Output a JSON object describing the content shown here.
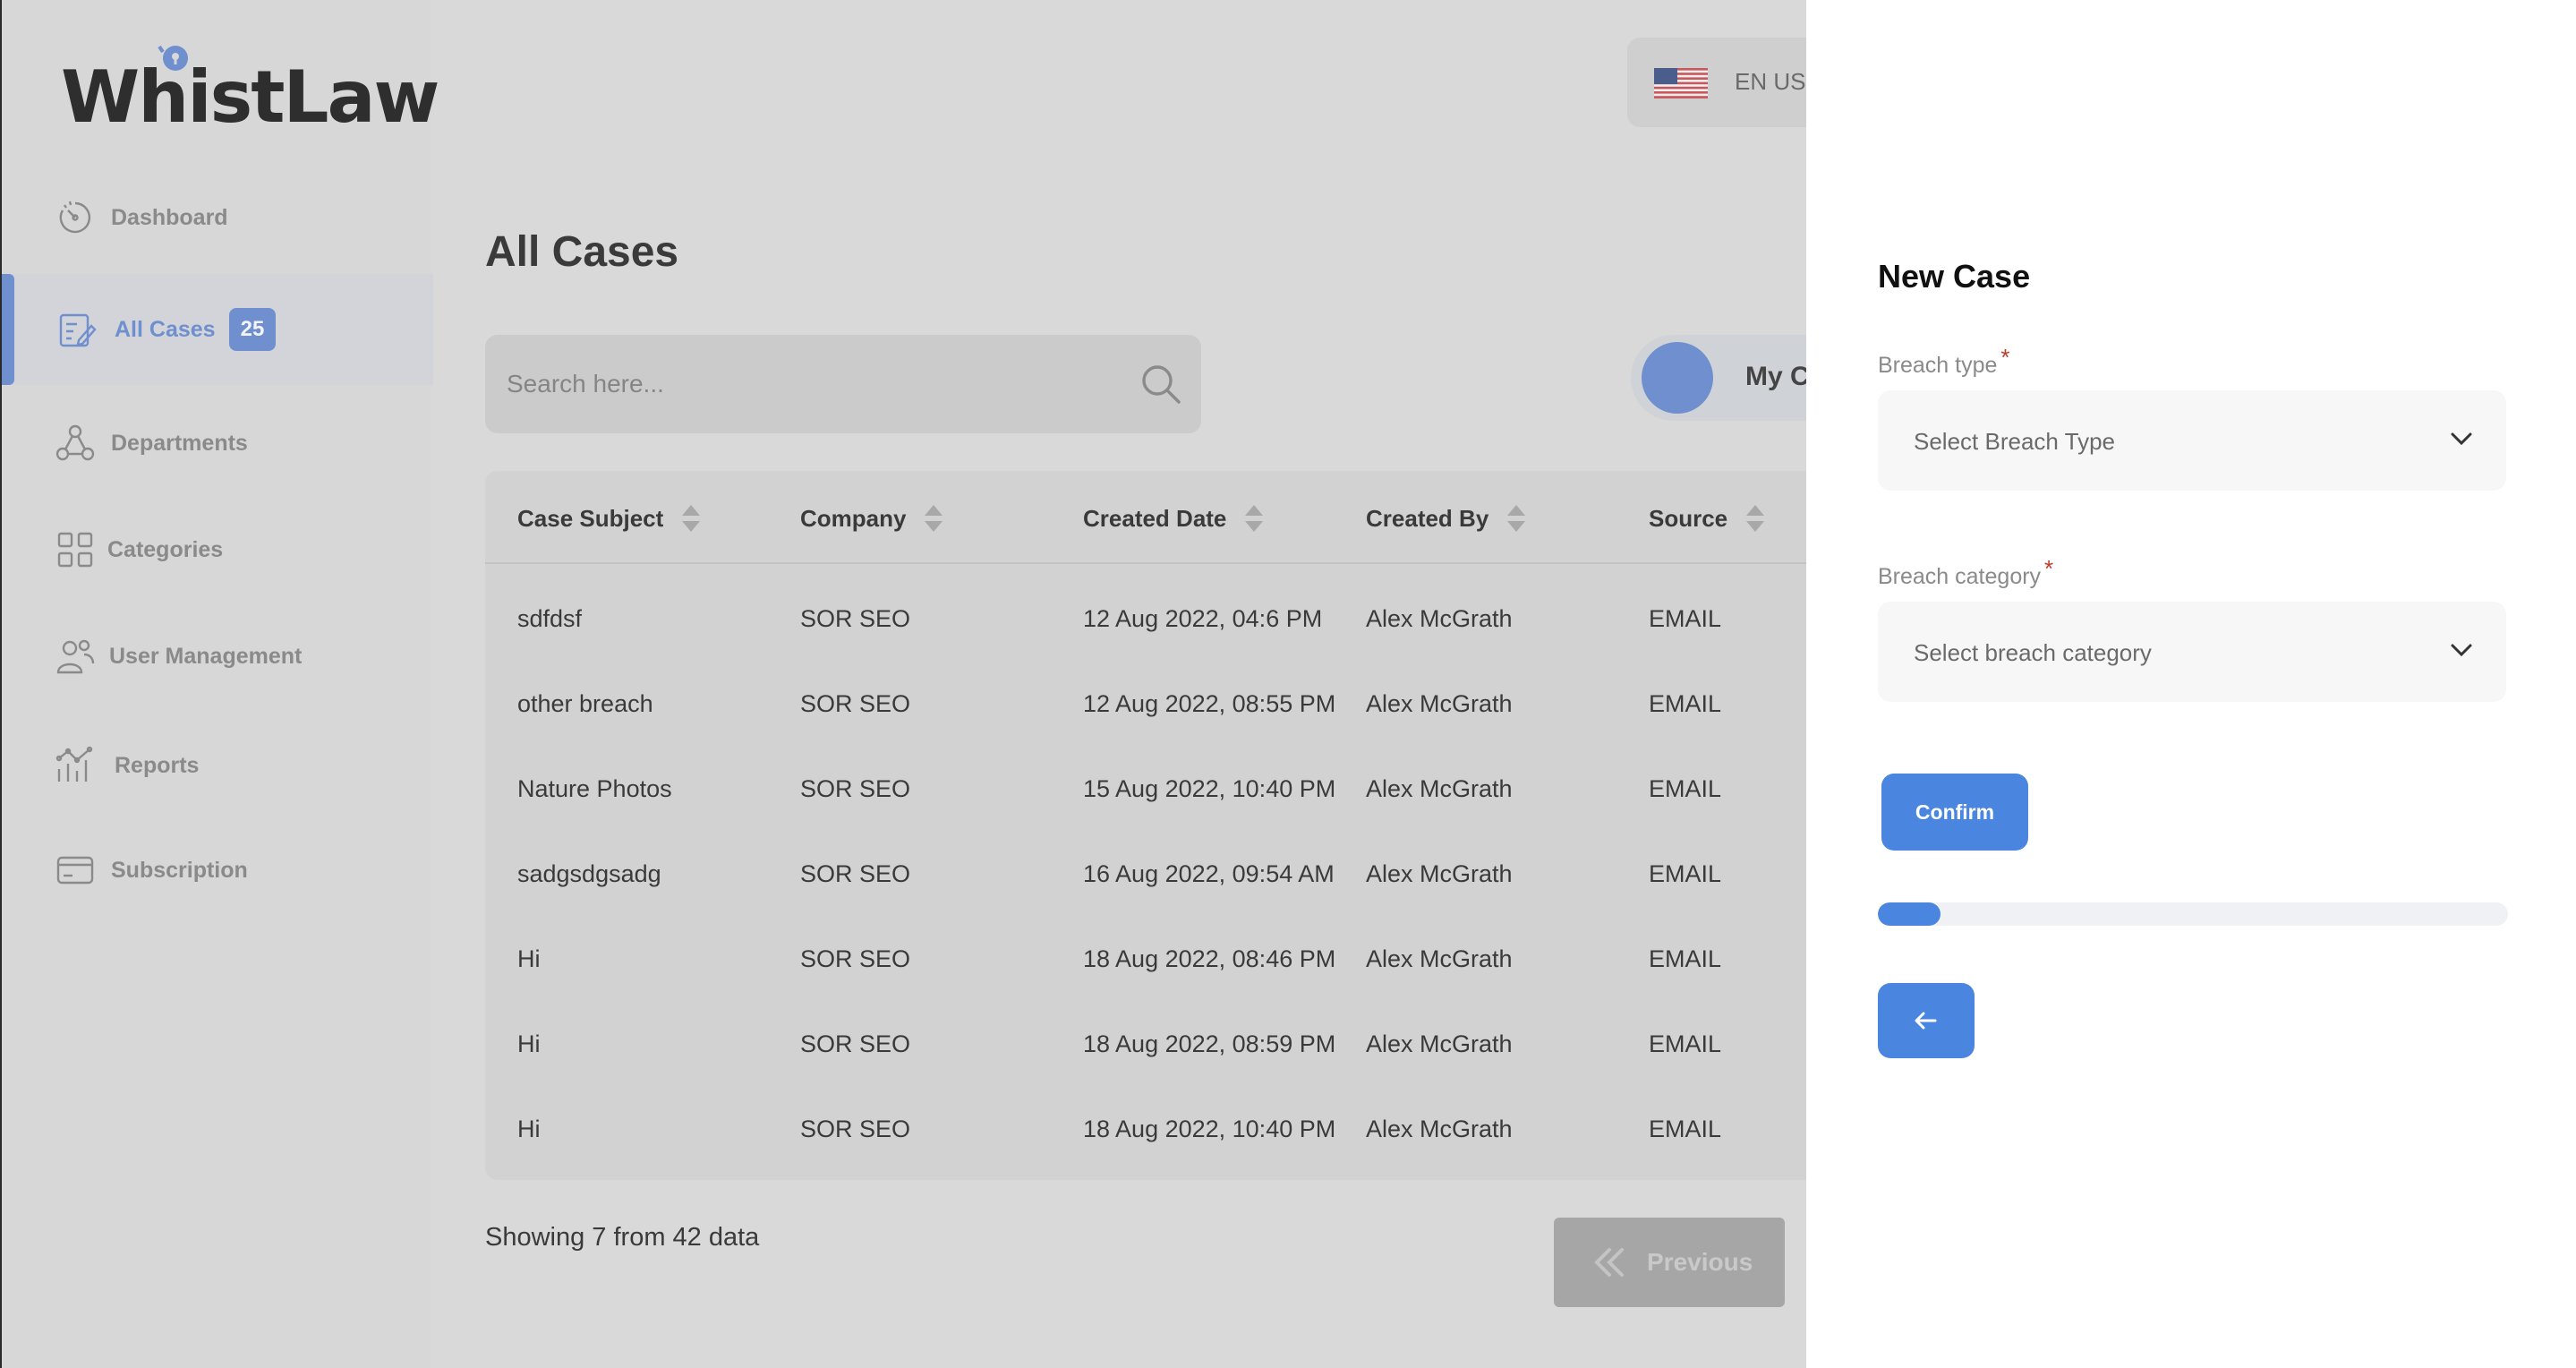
{
  "app": {
    "logo_text": "WhistLaw"
  },
  "sidebar": {
    "items": [
      {
        "label": "Dashboard",
        "icon": "dashboard-gauge-icon"
      },
      {
        "label": "All Cases",
        "icon": "cases-edit-icon",
        "badge": "25",
        "active": true
      },
      {
        "label": "Departments",
        "icon": "departments-network-icon"
      },
      {
        "label": "Categories",
        "icon": "categories-grid-icon"
      },
      {
        "label": "User Management",
        "icon": "users-icon"
      },
      {
        "label": "Reports",
        "icon": "reports-chart-icon"
      },
      {
        "label": "Subscription",
        "icon": "credit-card-icon"
      }
    ]
  },
  "header": {
    "language": "EN US",
    "flag_icon": "us-flag-icon"
  },
  "main": {
    "title": "All Cases",
    "search": {
      "placeholder": "Search here..."
    },
    "toggle_label": "My Ca",
    "table": {
      "columns": [
        "Case Subject",
        "Company",
        "Created Date",
        "Created By",
        "Source"
      ],
      "rows": [
        [
          "sdfdsf",
          "SOR SEO",
          "12 Aug 2022, 04:6 PM",
          "Alex McGrath",
          "EMAIL"
        ],
        [
          "other breach",
          "SOR SEO",
          "12 Aug 2022, 08:55 PM",
          "Alex McGrath",
          "EMAIL"
        ],
        [
          "Nature Photos",
          "SOR SEO",
          "15 Aug 2022, 10:40 PM",
          "Alex McGrath",
          "EMAIL"
        ],
        [
          "sadgsdgsadg",
          "SOR SEO",
          "16 Aug 2022, 09:54 AM",
          "Alex McGrath",
          "EMAIL"
        ],
        [
          "Hi",
          "SOR SEO",
          "18 Aug 2022, 08:46 PM",
          "Alex McGrath",
          "EMAIL"
        ],
        [
          "Hi",
          "SOR SEO",
          "18 Aug 2022, 08:59 PM",
          "Alex McGrath",
          "EMAIL"
        ],
        [
          "Hi",
          "SOR SEO",
          "18 Aug 2022, 10:40 PM",
          "Alex McGrath",
          "EMAIL"
        ]
      ]
    },
    "showing_text": "Showing 7 from 42 data",
    "pagination": {
      "previous_label": "Previous"
    }
  },
  "drawer": {
    "title": "New Case",
    "breach_type": {
      "label": "Breach type",
      "required_mark": "*",
      "placeholder": "Select Breach Type"
    },
    "breach_category": {
      "label": "Breach category",
      "required_mark": "*",
      "placeholder": "Select breach category"
    },
    "confirm_label": "Confirm",
    "progress_fraction": 0.1,
    "back_icon": "arrow-left-icon"
  },
  "colors": {
    "accent": "#4a86e0",
    "sidebar_active": "#6f8fce",
    "overlay_bg": "#d9d9d9",
    "required": "#c0392b"
  }
}
